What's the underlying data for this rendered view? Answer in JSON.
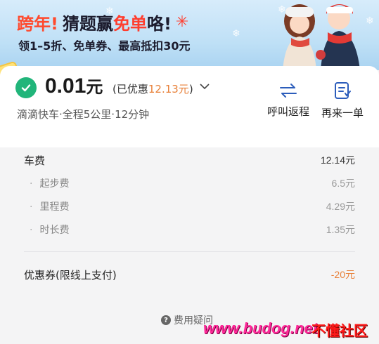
{
  "banner": {
    "title_part1": "跨年!",
    "title_part2": "猜题赢",
    "title_part3": "免单",
    "title_part4": "咯!",
    "subtitle": "领1–5折、免单券、最高抵扣30元"
  },
  "trip": {
    "price": "0.01",
    "price_unit": "元",
    "discount_prefix": "(已优惠",
    "discount_amount": "12.13元",
    "discount_suffix": ")",
    "route_info": "滴滴快车·全程5公里·12分钟"
  },
  "actions": {
    "return_trip": "呼叫返程",
    "repeat_order": "再来一单"
  },
  "fees": {
    "fare_label": "车费",
    "fare_value": "12.14元",
    "items": [
      {
        "label": "起步费",
        "value": "6.5元"
      },
      {
        "label": "里程费",
        "value": "4.29元"
      },
      {
        "label": "时长费",
        "value": "1.35元"
      }
    ],
    "coupon_label": "优惠券(限线上支付)",
    "coupon_value": "-20元",
    "faq_label": "费用疑问"
  },
  "watermark": {
    "site": "www.budog.net",
    "name": "不懂社区"
  },
  "colors": {
    "accent_green": "#21b57a",
    "discount_orange": "#e8813a",
    "banner_red": "#ff3d2e"
  }
}
